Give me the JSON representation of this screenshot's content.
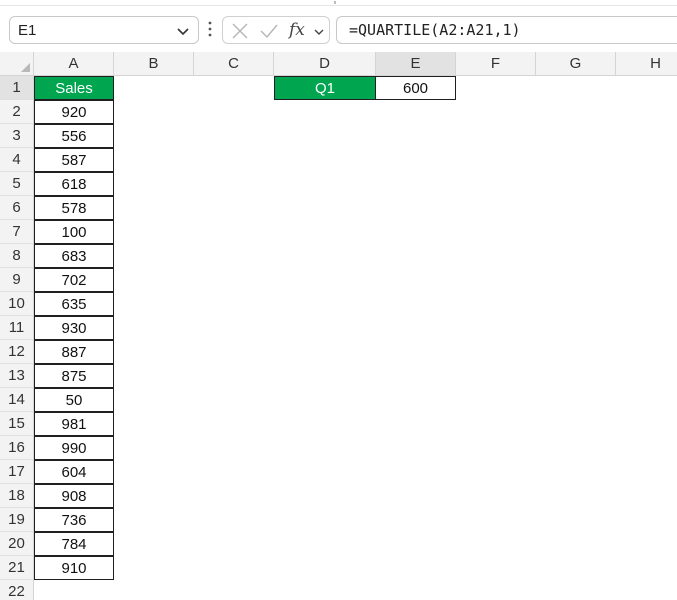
{
  "name_box": {
    "value": "E1"
  },
  "formula_bar": {
    "formula": "=QUARTILE(A2:A21,1)",
    "fx_label": "fx"
  },
  "columns": [
    "A",
    "B",
    "C",
    "D",
    "E",
    "F",
    "G",
    "H"
  ],
  "rows": [
    "1",
    "2",
    "3",
    "4",
    "5",
    "6",
    "7",
    "8",
    "9",
    "10",
    "11",
    "12",
    "13",
    "14",
    "15",
    "16",
    "17",
    "18",
    "19",
    "20",
    "21",
    "22"
  ],
  "sheet": {
    "sales_header": "Sales",
    "sales_values": [
      "920",
      "556",
      "587",
      "618",
      "578",
      "100",
      "683",
      "702",
      "635",
      "930",
      "887",
      "875",
      "50",
      "981",
      "990",
      "604",
      "908",
      "736",
      "784",
      "910"
    ],
    "q1_label": "Q1",
    "q1_value": "600"
  },
  "colors": {
    "header_fill": "#00a550",
    "header_text": "#ffffff"
  }
}
